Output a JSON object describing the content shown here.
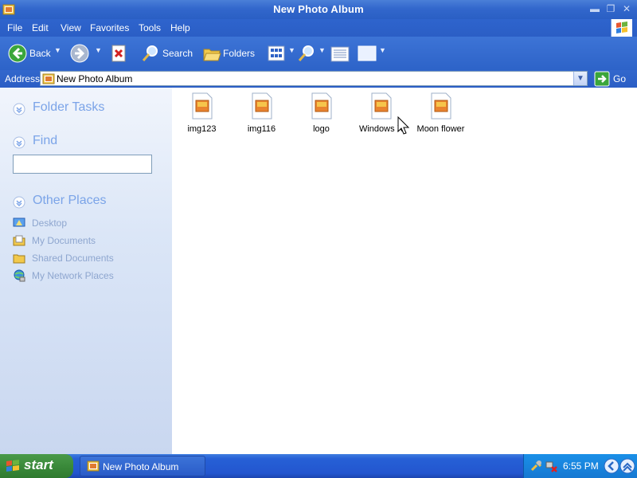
{
  "window": {
    "title": "New Photo Album"
  },
  "menu": [
    "File",
    "Edit",
    "View",
    "Favorites",
    "Tools",
    "Help"
  ],
  "toolbar": {
    "back_label": "Back",
    "search_label": "Search",
    "folders_label": "Folders"
  },
  "address": {
    "label": "Address",
    "value": "New Photo Album",
    "go_label": "Go"
  },
  "sidebar": {
    "folder_tasks": "Folder Tasks",
    "find": "Find",
    "find_placeholder": "",
    "other_places": "Other Places",
    "places": [
      "Desktop",
      "My Documents",
      "Shared Documents",
      "My Network Places"
    ]
  },
  "files": [
    "img123",
    "img116",
    "logo",
    "Windows X",
    "Moon flower"
  ],
  "taskbar": {
    "start_label": "start",
    "task_label": "New Photo Album",
    "clock": "6:55 PM"
  },
  "colors": {
    "titlebar": "#3267cc",
    "sidebar_link": "#7ba4e8",
    "taskbar": "#2356cf",
    "start": "#3a8a3a"
  }
}
